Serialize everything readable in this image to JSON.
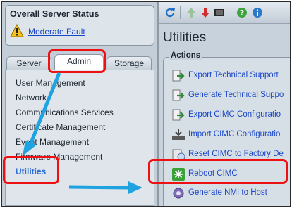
{
  "status": {
    "title": "Overall Server Status",
    "fault_label": "Moderate Fault"
  },
  "tabs": {
    "server": "Server",
    "admin": "Admin",
    "storage": "Storage"
  },
  "menu": {
    "items": [
      "User Management",
      "Network",
      "Communications Services",
      "Certificate Management",
      "Event Management",
      "Firmware Management",
      "Utilities"
    ]
  },
  "page": {
    "title": "Utilities",
    "actions_label": "Actions"
  },
  "actions": [
    "Export Technical Support",
    "Generate Technical Suppo",
    "Export CIMC Configuratio",
    "Import CIMC Configuratio",
    "Reset CIMC to Factory De",
    "Reboot CIMC",
    "Generate NMI to Host"
  ],
  "colors": {
    "annotation": "#ee1111",
    "arrow": "#1fa3e0",
    "link": "#1a47c8",
    "active_menu": "#2d6fd6"
  }
}
